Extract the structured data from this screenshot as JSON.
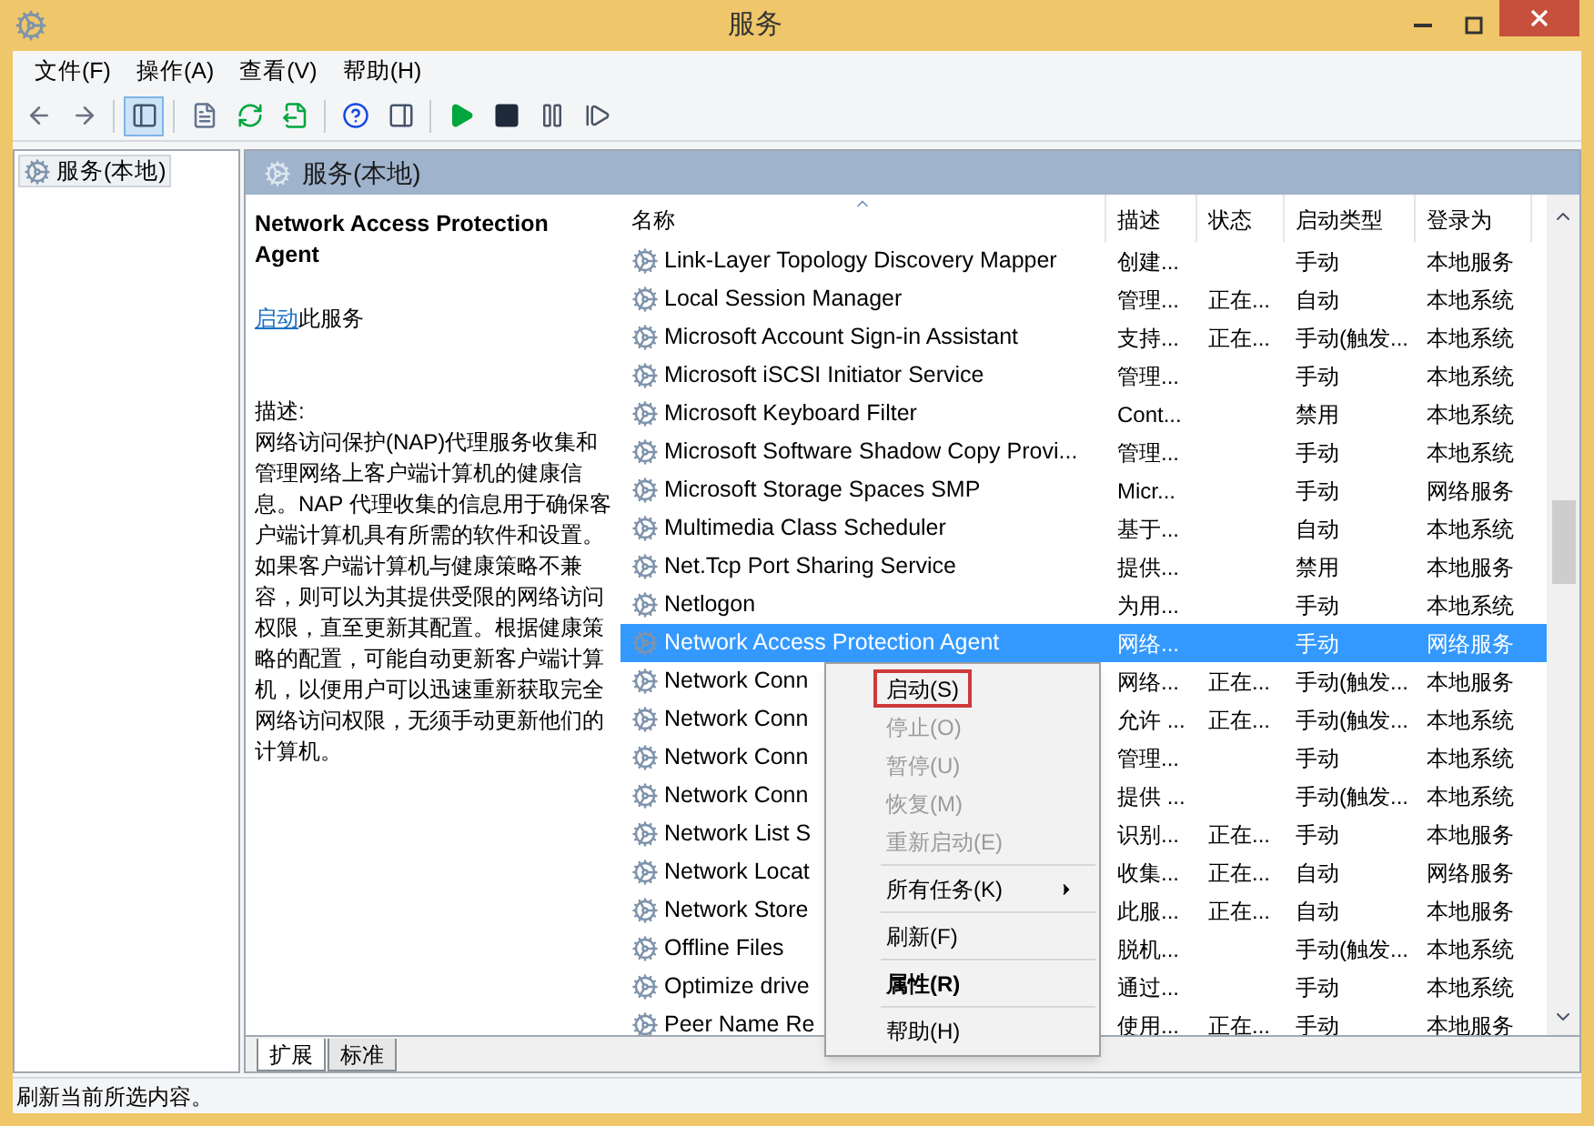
{
  "window": {
    "title": "服务"
  },
  "menu_bar": [
    "文件(F)",
    "操作(A)",
    "查看(V)",
    "帮助(H)"
  ],
  "toolbar": [
    {
      "kind": "back",
      "pressed": false
    },
    {
      "kind": "forward",
      "pressed": false
    },
    {
      "kind": "separator"
    },
    {
      "kind": "console-tree",
      "pressed": true
    },
    {
      "kind": "separator"
    },
    {
      "kind": "properties",
      "pressed": false
    },
    {
      "kind": "refresh",
      "pressed": false
    },
    {
      "kind": "export",
      "pressed": false
    },
    {
      "kind": "separator"
    },
    {
      "kind": "help",
      "pressed": false
    },
    {
      "kind": "action-pane",
      "pressed": false
    },
    {
      "kind": "separator"
    },
    {
      "kind": "start",
      "pressed": false
    },
    {
      "kind": "stop",
      "pressed": false
    },
    {
      "kind": "pause",
      "pressed": false
    },
    {
      "kind": "resume",
      "pressed": false
    }
  ],
  "tree": {
    "items": [
      {
        "label": "服务(本地)",
        "selected": true
      }
    ]
  },
  "pane_header": "服务(本地)",
  "details": {
    "title": "Network Access Protection Agent",
    "link": "启动",
    "link_suffix": "此服务",
    "description_label": "描述:",
    "description": "网络访问保护(NAP)代理服务收集和管理网络上客户端计算机的健康信息。NAP 代理收集的信息用于确保客户端计算机具有所需的软件和设置。如果客户端计算机与健康策略不兼容，则可以为其提供受限的网络访问权限，直至更新其配置。根据健康策略的配置，可能自动更新客户端计算机，以便用户可以迅速重新获取完全网络访问权限，无须手动更新他们的计算机。"
  },
  "table": {
    "columns": [
      {
        "label": "名称",
        "sorted": true
      },
      {
        "label": "描述",
        "sorted": false
      },
      {
        "label": "状态",
        "sorted": false
      },
      {
        "label": "启动类型",
        "sorted": false
      },
      {
        "label": "登录为",
        "sorted": false
      }
    ],
    "rows": [
      {
        "name": "Link-Layer Topology Discovery Mapper",
        "description": "创建...",
        "startup": "手动",
        "logon": "本地服务",
        "selected": false
      },
      {
        "name": "Local Session Manager",
        "description": "管理...",
        "status": "正在...",
        "startup": "自动",
        "logon": "本地系统",
        "selected": false
      },
      {
        "name": "Microsoft Account Sign-in Assistant",
        "description": "支持...",
        "status": "正在...",
        "startup": "手动(触发...",
        "logon": "本地系统",
        "selected": false
      },
      {
        "name": "Microsoft iSCSI Initiator Service",
        "description": "管理...",
        "startup": "手动",
        "logon": "本地系统",
        "selected": false
      },
      {
        "name": "Microsoft Keyboard Filter",
        "description": "Cont...",
        "startup": "禁用",
        "logon": "本地系统",
        "selected": false
      },
      {
        "name": "Microsoft Software Shadow Copy Provi...",
        "description": "管理...",
        "startup": "手动",
        "logon": "本地系统",
        "selected": false
      },
      {
        "name": "Microsoft Storage Spaces SMP",
        "description": "Micr...",
        "startup": "手动",
        "logon": "网络服务",
        "selected": false
      },
      {
        "name": "Multimedia Class Scheduler",
        "description": "基于...",
        "startup": "自动",
        "logon": "本地系统",
        "selected": false
      },
      {
        "name": "Net.Tcp Port Sharing Service",
        "description": "提供...",
        "startup": "禁用",
        "logon": "本地服务",
        "selected": false
      },
      {
        "name": "Netlogon",
        "description": "为用...",
        "startup": "手动",
        "logon": "本地系统",
        "selected": false
      },
      {
        "name": "Network Access Protection Agent",
        "description": "网络...",
        "startup": "手动",
        "logon": "网络服务",
        "selected": true
      },
      {
        "name": "Network Conn",
        "description": "网络...",
        "status": "正在...",
        "startup": "手动(触发...",
        "logon": "本地服务",
        "selected": false
      },
      {
        "name": "Network Conn",
        "description": "允许 ...",
        "status": "正在...",
        "startup": "手动(触发...",
        "logon": "本地系统",
        "selected": false
      },
      {
        "name": "Network Conn",
        "description": "管理...",
        "startup": "手动",
        "logon": "本地系统",
        "selected": false
      },
      {
        "name": "Network Conn",
        "description": "提供 ...",
        "startup": "手动(触发...",
        "logon": "本地系统",
        "selected": false
      },
      {
        "name": "Network List S",
        "description": "识别...",
        "status": "正在...",
        "startup": "手动",
        "logon": "本地服务",
        "selected": false
      },
      {
        "name": "Network Locat",
        "description": "收集...",
        "status": "正在...",
        "startup": "自动",
        "logon": "网络服务",
        "selected": false
      },
      {
        "name": "Network Store",
        "description": "此服...",
        "status": "正在...",
        "startup": "自动",
        "logon": "本地服务",
        "selected": false
      },
      {
        "name": "Offline Files",
        "description": "脱机...",
        "startup": "手动(触发...",
        "logon": "本地系统",
        "selected": false
      },
      {
        "name": "Optimize drive",
        "description": "通过...",
        "startup": "手动",
        "logon": "本地系统",
        "selected": false
      },
      {
        "name": "Peer Name Re",
        "description": "使用...",
        "status": "正在...",
        "startup": "手动",
        "logon": "本地服务",
        "selected": false
      }
    ]
  },
  "context_menu": {
    "items": [
      {
        "kind": "item",
        "label": "启动(S)",
        "disabled": false,
        "highlighted": true,
        "bold": false,
        "submenu": false
      },
      {
        "kind": "item",
        "label": "停止(O)",
        "disabled": true,
        "highlighted": false,
        "bold": false,
        "submenu": false
      },
      {
        "kind": "item",
        "label": "暂停(U)",
        "disabled": true,
        "highlighted": false,
        "bold": false,
        "submenu": false
      },
      {
        "kind": "item",
        "label": "恢复(M)",
        "disabled": true,
        "highlighted": false,
        "bold": false,
        "submenu": false
      },
      {
        "kind": "item",
        "label": "重新启动(E)",
        "disabled": true,
        "highlighted": false,
        "bold": false,
        "submenu": false
      },
      {
        "kind": "separator"
      },
      {
        "kind": "item",
        "label": "所有任务(K)",
        "disabled": false,
        "highlighted": false,
        "bold": false,
        "submenu": true
      },
      {
        "kind": "separator"
      },
      {
        "kind": "item",
        "label": "刷新(F)",
        "disabled": false,
        "highlighted": false,
        "bold": false,
        "submenu": false
      },
      {
        "kind": "separator"
      },
      {
        "kind": "item",
        "label": "属性(R)",
        "disabled": false,
        "highlighted": false,
        "bold": true,
        "submenu": false
      },
      {
        "kind": "separator"
      },
      {
        "kind": "item",
        "label": "帮助(H)",
        "disabled": false,
        "highlighted": false,
        "bold": false,
        "submenu": false
      }
    ]
  },
  "bottom_tabs": [
    {
      "label": "扩展",
      "selected": true
    },
    {
      "label": "标准",
      "selected": false
    }
  ],
  "status_bar": "刷新当前所选内容。"
}
